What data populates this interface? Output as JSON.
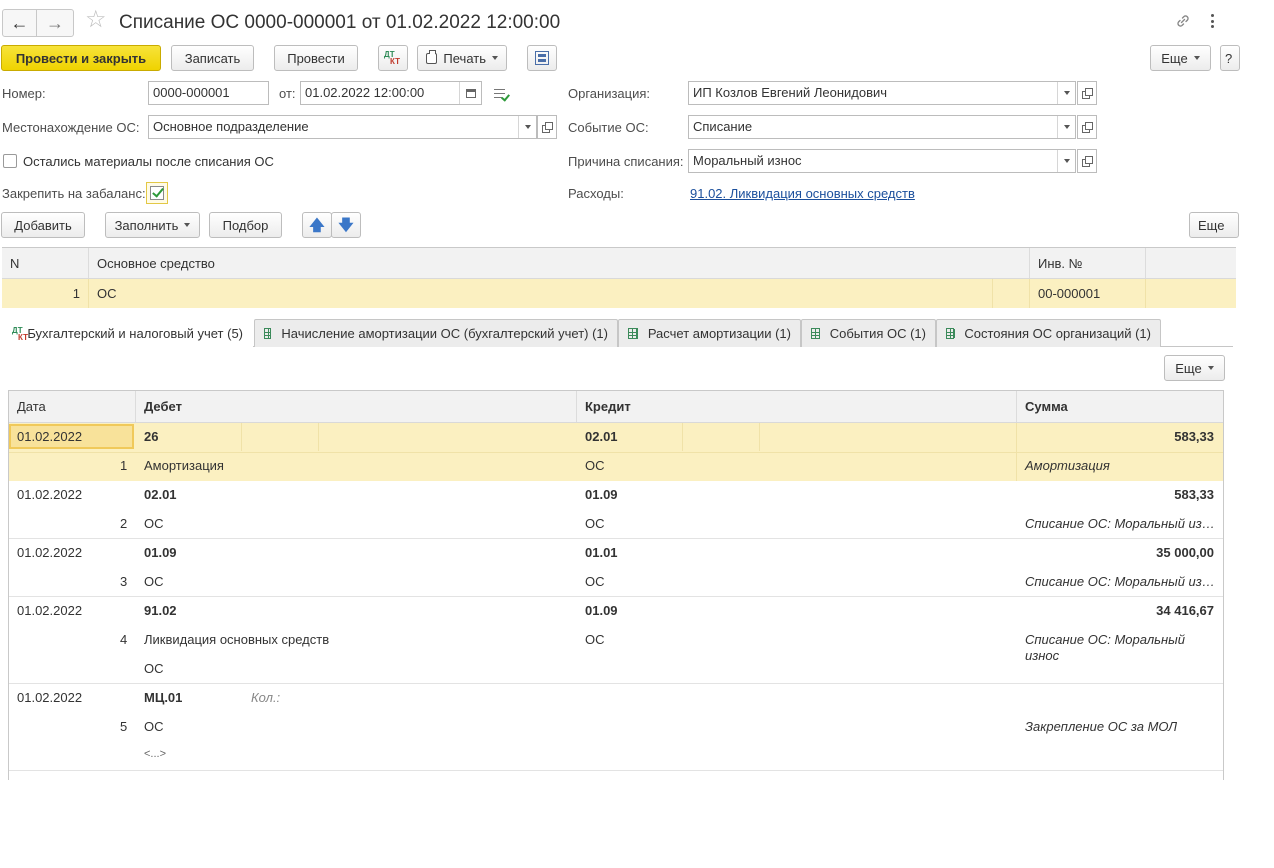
{
  "window": {
    "title": "Списание ОС 0000-000001 от 01.02.2022 12:00:00"
  },
  "toolbar": {
    "post_and_close": "Провести и закрыть",
    "save": "Записать",
    "post": "Провести",
    "print": "Печать",
    "more": "Еще",
    "help": "?"
  },
  "form": {
    "number_label": "Номер:",
    "number_value": "0000-000001",
    "date_label": "от:",
    "date_value": "01.02.2022 12:00:00",
    "org_label": "Организация:",
    "org_value": "ИП Козлов Евгений Леонидович",
    "location_label": "Местонахождение ОС:",
    "location_value": "Основное подразделение",
    "event_label": "Событие ОС:",
    "event_value": "Списание",
    "materials_label": "Остались материалы после списания ОС",
    "reason_label": "Причина списания:",
    "reason_value": "Моральный износ",
    "offbalance_label": "Закрепить на забаланс:",
    "expenses_label": "Расходы:",
    "expenses_link": "91.02. Ликвидация основных средств"
  },
  "table_toolbar": {
    "add": "Добавить",
    "fill": "Заполнить",
    "select": "Подбор",
    "more": "Еще"
  },
  "assets_table": {
    "headers": [
      "N",
      "Основное средство",
      "Инв. №"
    ],
    "rows": [
      {
        "n": "1",
        "asset": "ОС",
        "inv": "00-000001"
      }
    ]
  },
  "tabs": [
    {
      "label": "Бухгалтерский и налоговый учет (5)"
    },
    {
      "label": "Начисление амортизации ОС (бухгалтерский учет) (1)"
    },
    {
      "label": "Расчет амортизации (1)"
    },
    {
      "label": "События ОС (1)"
    },
    {
      "label": "Состояния ОС организаций (1)"
    }
  ],
  "postings": {
    "more": "Еще",
    "headers": [
      "Дата",
      "Дебет",
      "Кредит",
      "Сумма"
    ],
    "rows": [
      {
        "date": "01.02.2022",
        "n": "1",
        "debit": "26",
        "debit_sub": "Амортизация",
        "credit": "02.01",
        "credit_sub": "ОС",
        "sum": "583,33",
        "content": "Амортизация"
      },
      {
        "date": "01.02.2022",
        "n": "2",
        "debit": "02.01",
        "debit_sub": "ОС",
        "credit": "01.09",
        "credit_sub": "ОС",
        "sum": "583,33",
        "content": "Списание ОС: Моральный из…"
      },
      {
        "date": "01.02.2022",
        "n": "3",
        "debit": "01.09",
        "debit_sub": "ОС",
        "credit": "01.01",
        "credit_sub": "ОС",
        "sum": "35 000,00",
        "content": "Списание ОС: Моральный из…"
      },
      {
        "date": "01.02.2022",
        "n": "4",
        "debit": "91.02",
        "debit_sub": "Ликвидация основных средств",
        "debit_sub2": "ОС",
        "credit": "01.09",
        "credit_sub": "ОС",
        "sum": "34 416,67",
        "content": "Списание ОС: Моральный",
        "content2": "износ"
      },
      {
        "date": "01.02.2022",
        "n": "5",
        "debit": "МЦ.01",
        "debit_qty": "Кол.:",
        "debit_sub": "ОС",
        "debit_sub2": "<...>",
        "credit": "",
        "credit_sub": "",
        "sum": "",
        "content": "Закрепление ОС за МОЛ"
      }
    ]
  }
}
